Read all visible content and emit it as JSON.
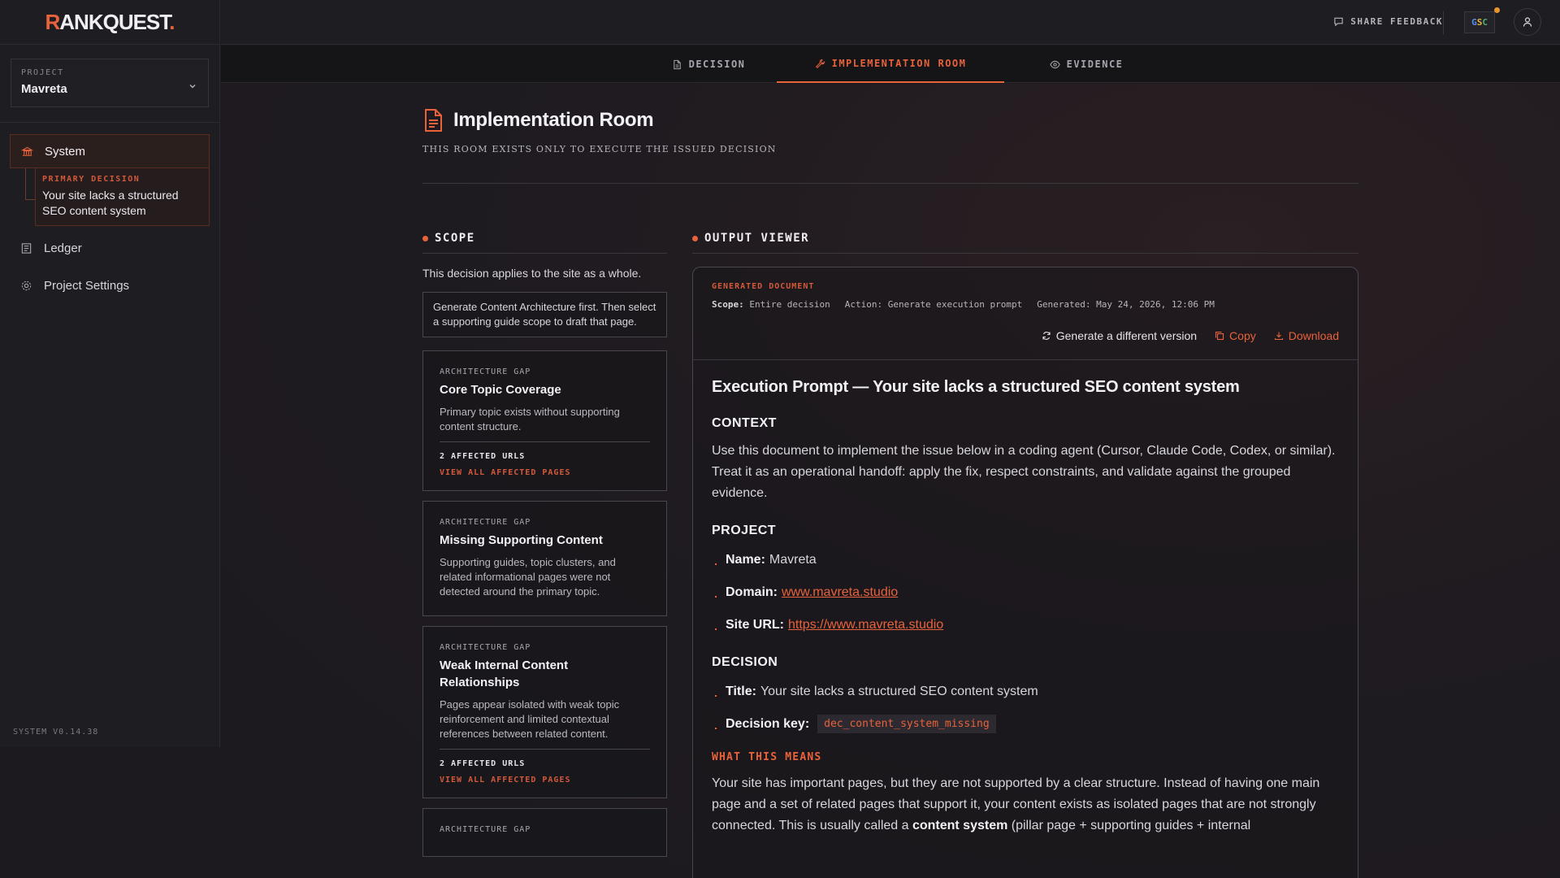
{
  "brand": {
    "first": "R",
    "rest": "ANKQUEST",
    "dot": "."
  },
  "project": {
    "label": "PROJECT",
    "name": "Mavreta"
  },
  "sidebar": {
    "items": [
      {
        "label": "System"
      },
      {
        "label": "Ledger"
      },
      {
        "label": "Project Settings"
      }
    ],
    "sub": {
      "label": "PRIMARY DECISION",
      "text": "Your site lacks a structured SEO content system"
    },
    "version": "SYSTEM V0.14.38"
  },
  "topbar": {
    "feedback": "SHARE FEEDBACK",
    "gsc": {
      "g": "G",
      "s": "S",
      "c": "C"
    }
  },
  "tabs": [
    {
      "label": "DECISION"
    },
    {
      "label": "IMPLEMENTATION ROOM"
    },
    {
      "label": "EVIDENCE"
    }
  ],
  "page": {
    "title": "Implementation Room",
    "subtitle": "THIS ROOM EXISTS ONLY TO EXECUTE THE ISSUED DECISION"
  },
  "scope": {
    "heading": "SCOPE",
    "desc": "This decision applies to the site as a whole.",
    "note": "Generate Content Architecture first. Then select a supporting guide scope to draft that page.",
    "cards": [
      {
        "kicker": "ARCHITECTURE GAP",
        "title": "Core Topic Coverage",
        "desc": "Primary topic exists without supporting content structure.",
        "count": "2 AFFECTED URLS",
        "link": "VIEW ALL AFFECTED PAGES"
      },
      {
        "kicker": "ARCHITECTURE GAP",
        "title": "Missing Supporting Content",
        "desc": "Supporting guides, topic clusters, and related informational pages were not detected around the primary topic."
      },
      {
        "kicker": "ARCHITECTURE GAP",
        "title": "Weak Internal Content Relationships",
        "desc": "Pages appear isolated with weak topic reinforcement and limited contextual references between related content.",
        "count": "2 AFFECTED URLS",
        "link": "VIEW ALL AFFECTED PAGES"
      },
      {
        "kicker": "ARCHITECTURE GAP"
      }
    ]
  },
  "output": {
    "heading": "OUTPUT VIEWER",
    "kicker": "GENERATED DOCUMENT",
    "meta": {
      "scope_label": "Scope:",
      "scope": "Entire decision",
      "action_label": "Action:",
      "action": "Generate execution prompt",
      "generated_label": "Generated:",
      "generated": "May 24, 2026, 12:06 PM"
    },
    "actions": {
      "regen": "Generate a different version",
      "copy": "Copy",
      "download": "Download"
    },
    "doc": {
      "title": "Execution Prompt — Your site lacks a structured SEO content system",
      "context_h": "CONTEXT",
      "context_p": "Use this document to implement the issue below in a coding agent (Cursor, Claude Code, Codex, or similar). Treat it as an operational handoff: apply the fix, respect constraints, and validate against the grouped evidence.",
      "project_h": "PROJECT",
      "name_label": "Name:",
      "name": "Mavreta",
      "domain_label": "Domain:",
      "domain": "www.mavreta.studio",
      "url_label": "Site URL:",
      "url": "https://www.mavreta.studio",
      "decision_h": "DECISION",
      "title_label": "Title:",
      "title_val": "Your site lacks a structured SEO content system",
      "key_label": "Decision key:",
      "key": "dec_content_system_missing",
      "means_h": "WHAT THIS MEANS",
      "means_p1": "Your site has important pages, but they are not supported by a clear structure. Instead of having one main page and a set of related pages that support it, your content exists as isolated pages that are not strongly connected. This is usually called a ",
      "means_bold": "content system",
      "means_p2": " (pillar page + supporting guides + internal"
    }
  }
}
